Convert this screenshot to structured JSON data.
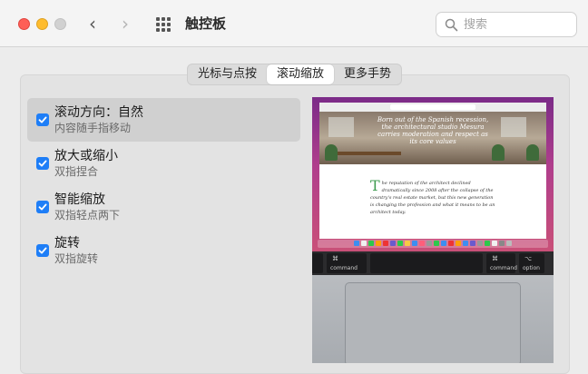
{
  "window": {
    "title": "触控板"
  },
  "toolbar": {
    "back_label": "‹",
    "forward_label": "›"
  },
  "search": {
    "placeholder": "搜索"
  },
  "tabs": [
    {
      "label": "光标与点按",
      "active": false
    },
    {
      "label": "滚动缩放",
      "active": true
    },
    {
      "label": "更多手势",
      "active": false
    }
  ],
  "options": [
    {
      "label": "滚动方向：自然",
      "sub": "内容随手指移动",
      "checked": true,
      "selected": true
    },
    {
      "label": "放大或缩小",
      "sub": "双指捏合",
      "checked": true,
      "selected": false
    },
    {
      "label": "智能缩放",
      "sub": "双指轻点两下",
      "checked": true,
      "selected": false
    },
    {
      "label": "旋转",
      "sub": "双指旋转",
      "checked": true,
      "selected": false
    }
  ],
  "preview": {
    "hero_title": "Born out of the Spanish recession, the architectural studio Mesura carries moderation and respect as its core values",
    "article_dropcap": "T",
    "article_text": "he reputation of the architect declined dramatically since 2008 after the collapse of the country's real estate market, but this new generation is changing the profession and what it means to be an architect today.",
    "keys": [
      {
        "glyph": "⌘",
        "word": "command"
      },
      {
        "glyph": "⌘",
        "word": "command"
      },
      {
        "glyph": "⌥",
        "word": "option"
      }
    ]
  },
  "colors": {
    "accent": "#1e7ef7",
    "close": "#fe5f57",
    "minimize": "#febc2e",
    "zoom_disabled": "#d1d1d1"
  }
}
